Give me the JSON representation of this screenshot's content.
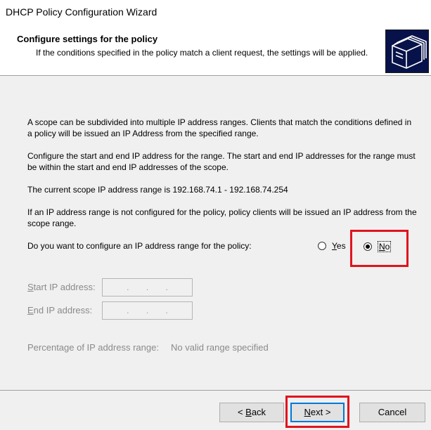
{
  "window": {
    "title": "DHCP Policy Configuration Wizard"
  },
  "header": {
    "title": "Configure settings for the policy",
    "subtitle": "If the conditions specified in the policy match a client request, the settings will be applied.",
    "icon": "folders-icon"
  },
  "content": {
    "para1": "A scope can be subdivided into multiple IP address ranges. Clients that match the conditions defined in a policy will be issued an IP Address from the specified range.",
    "para2": "Configure the start and end IP address for the range. The start and end IP addresses for the range must be within the start and end IP addresses of the scope.",
    "para3": "The current scope IP address range is    192.168.74.1 - 192.168.74.254",
    "para4": "If an IP address range is not configured for the policy, policy clients will be issued an IP address from the scope range.",
    "question": "Do you want to configure an IP address range for the policy:",
    "options": {
      "yes": {
        "accel": "Y",
        "rest": "es",
        "selected": false
      },
      "no": {
        "accel": "N",
        "rest": "o",
        "selected": true
      }
    },
    "start_ip": {
      "accel": "S",
      "rest": "tart IP address:",
      "value": ". . ."
    },
    "end_ip": {
      "accel": "E",
      "rest": "nd IP address:",
      "value": ". . ."
    },
    "percentage": {
      "label": "Percentage of IP address range:",
      "value": "No valid range specified"
    }
  },
  "buttons": {
    "back": {
      "prefix": "< ",
      "accel": "B",
      "rest": "ack"
    },
    "next": {
      "accel": "N",
      "rest": "ext >"
    },
    "cancel": "Cancel"
  },
  "colors": {
    "highlight": "#e0141e",
    "header_icon_bg": "#08124a",
    "focus": "#0078d7"
  }
}
